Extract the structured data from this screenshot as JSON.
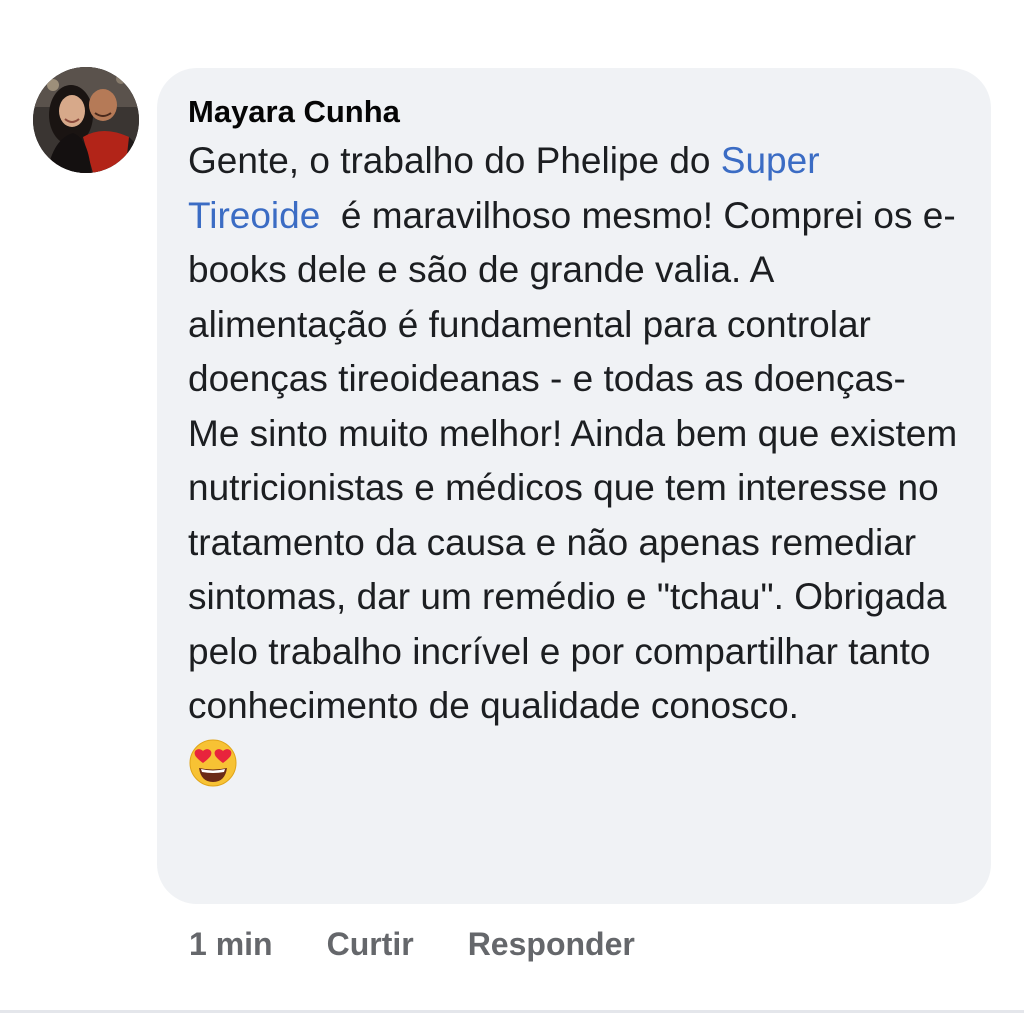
{
  "comment": {
    "author": "Mayara Cunha",
    "text_before_mention": "Gente, o trabalho do Phelipe do ",
    "mention": "Super Tireoide",
    "text_after_mention": "  é maravilhoso mesmo! Comprei os e-books dele e são de grande valia. A alimentação é fundamental para controlar doenças tireoideanas - e todas as doenças- Me sinto muito melhor! Ainda bem que existem nutricionistas e médicos que tem interesse no tratamento da causa e não apenas remediar sintomas, dar um remédio e \"tchau\". Obrigada pelo trabalho incrível e por compartilhar tanto conhecimento de qualidade conosco.",
    "emoji_icon": "heart-eyes-emoji-icon",
    "colors": {
      "bubble_background": "#f0f2f5",
      "mention": "#3b6cc4",
      "meta_text": "#65676b"
    }
  },
  "actions": {
    "time": "1 min",
    "like_label": "Curtir",
    "reply_label": "Responder"
  }
}
